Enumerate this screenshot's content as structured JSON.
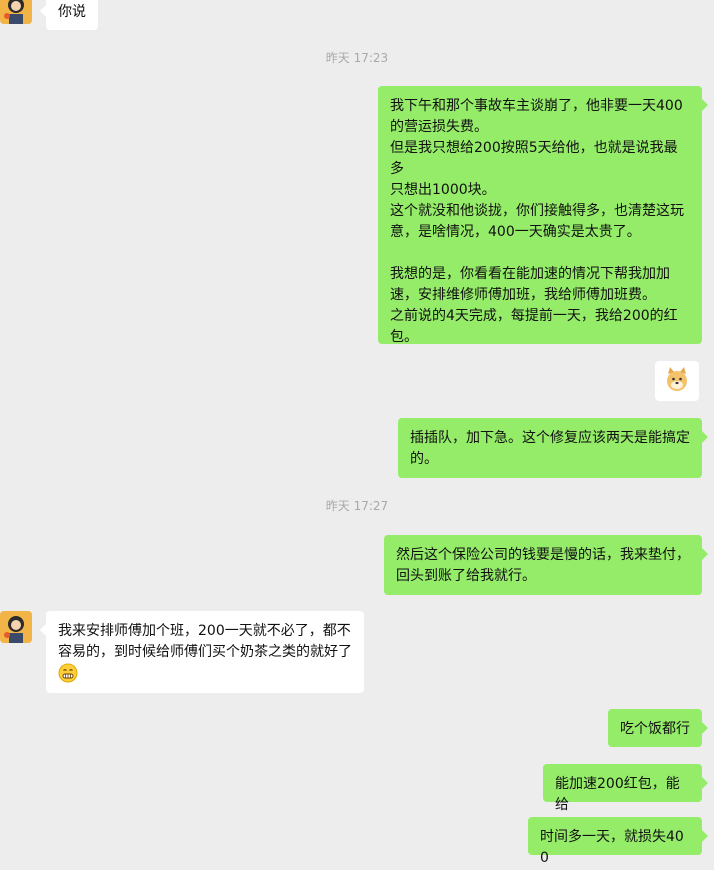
{
  "messages": {
    "m1": {
      "text": "你说"
    },
    "ts1": "昨天 17:23",
    "m2": {
      "text": "我下午和那个事故车主谈崩了，他非要一天400\n的营运损失费。\n但是我只想给200按照5天给他，也就是说我最多\n只想出1000块。\n这个就没和他谈拢，你们接触得多，也清楚这玩\n意，是啥情况，400一天确实是太贵了。\n\n我想的是，你看看在能加速的情况下帮我加加\n速，安排维修师傅加班，我给师傅加班费。\n之前说的4天完成，每提前一天，我给200的红\n包。"
    },
    "m3": {
      "sticker": "doge-emoji-icon"
    },
    "m4": {
      "text": "插插队，加下急。这个修复应该两天是能搞定\n的。"
    },
    "ts2": "昨天 17:27",
    "m5": {
      "text": "然后这个保险公司的钱要是慢的话，我来垫付，\n回头到账了给我就行。"
    },
    "m6": {
      "text": "我来安排师傅加个班，200一天就不必了，都不\n容易的，到时候给师傅们买个奶茶之类的就好了",
      "emoji": "grin-emoji-icon"
    },
    "m7": {
      "text": "吃个饭都行"
    },
    "m8": {
      "text": "能加速200红包，能给"
    },
    "m9": {
      "text": "时间多一天，就损失400"
    }
  },
  "colors": {
    "background": "#ededed",
    "outgoing_bubble": "#95ec69",
    "incoming_bubble": "#ffffff",
    "timestamp": "#a9a9a9"
  }
}
